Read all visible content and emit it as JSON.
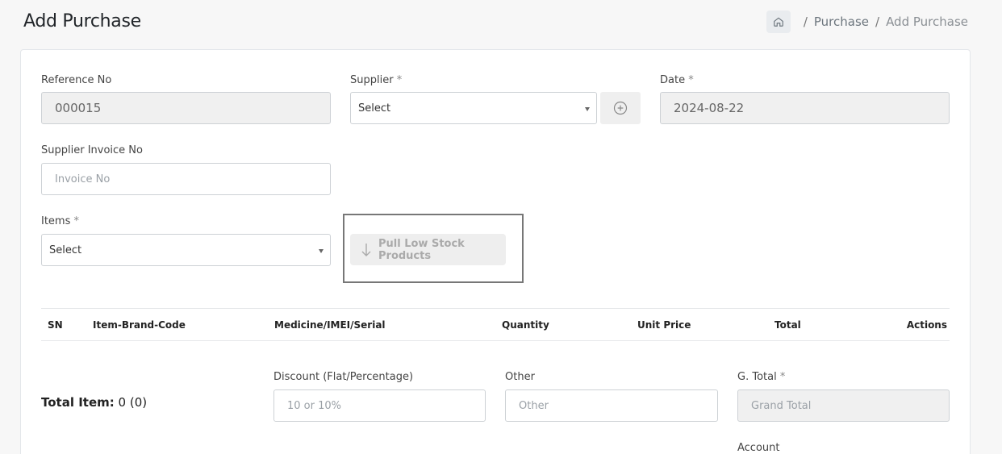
{
  "header": {
    "title": "Add Purchase",
    "breadcrumb": [
      "Purchase",
      "Add Purchase"
    ],
    "separator": "/"
  },
  "form": {
    "reference": {
      "label": "Reference No",
      "value": "000015"
    },
    "supplier": {
      "label": "Supplier",
      "required": "*",
      "value": "Select"
    },
    "date": {
      "label": "Date",
      "required": "*",
      "value": "2024-08-22"
    },
    "supplier_invoice": {
      "label": "Supplier Invoice No",
      "placeholder": "Invoice No"
    },
    "items": {
      "label": "Items",
      "required": "*",
      "value": "Select"
    },
    "pull_button": "Pull Low Stock Products"
  },
  "table": {
    "columns": [
      "SN",
      "Item-Brand-Code",
      "Medicine/IMEI/Serial",
      "Quantity",
      "Unit Price",
      "Total",
      "Actions"
    ]
  },
  "summary": {
    "total_item_label": "Total Item:",
    "total_item_value": "0 (0)",
    "discount": {
      "label": "Discount (Flat/Percentage)",
      "placeholder": "10 or 10%"
    },
    "other": {
      "label": "Other",
      "placeholder": "Other"
    },
    "grand_total": {
      "label": "G. Total",
      "required": "*",
      "placeholder": "Grand Total"
    },
    "account": {
      "label": "Account"
    }
  },
  "icons": {
    "home": "home-icon",
    "add": "plus-circle-icon",
    "pull": "arrow-down-icon",
    "caret": "caret-down-icon"
  },
  "colors": {
    "highlight_border": "#777777",
    "disabled_bg": "#f0f0f0"
  }
}
